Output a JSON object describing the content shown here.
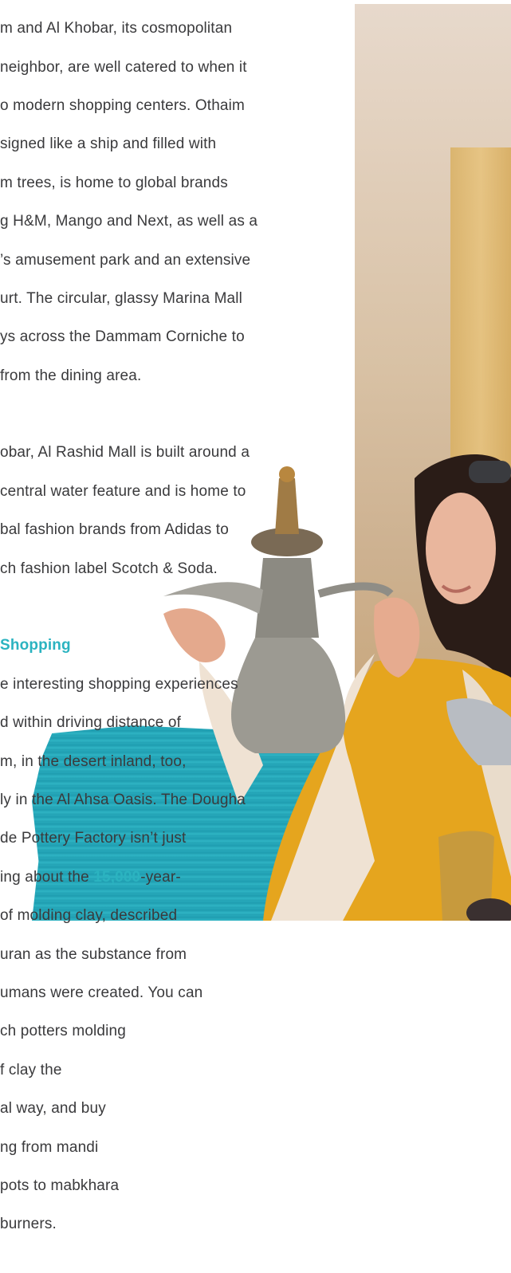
{
  "article": {
    "para1": [
      "m and Al Khobar, its cosmopolitan",
      "neighbor, are well catered to when it",
      "o modern shopping centers. Othaim",
      "signed like a ship and filled with",
      "m trees, is home to global brands",
      "g H&M, Mango and Next, as well as a",
      "’s amusement park and an extensive",
      "urt. The circular, glassy Marina Mall",
      "ys across the Dammam Corniche to",
      "from the dining area."
    ],
    "para2": [
      "obar, Al Rashid Mall is built around a",
      "central water feature and is home to",
      "bal fashion brands from Adidas to",
      "ch fashion label Scotch & Soda."
    ],
    "heading": "Shopping",
    "para3": {
      "lines_before": [
        "e interesting shopping experiences",
        "d within driving distance of",
        "m, in the desert inland, too,",
        "ly in the Al Ahsa Oasis. The Dougha",
        "de Pottery Factory isn’t just"
      ],
      "line_highlight_prefix": "ing about the ",
      "highlight": "15,000",
      "line_highlight_suffix": "-year-",
      "lines_after": [
        " of molding clay, described",
        "uran as the substance from",
        "umans were created. You can",
        "ch potters molding",
        "f clay the",
        "al way, and buy",
        "ng from mandi",
        " pots to mabkhara",
        "burners."
      ]
    }
  },
  "colors": {
    "text": "#3a3a3c",
    "accent": "#2bb3c0"
  }
}
